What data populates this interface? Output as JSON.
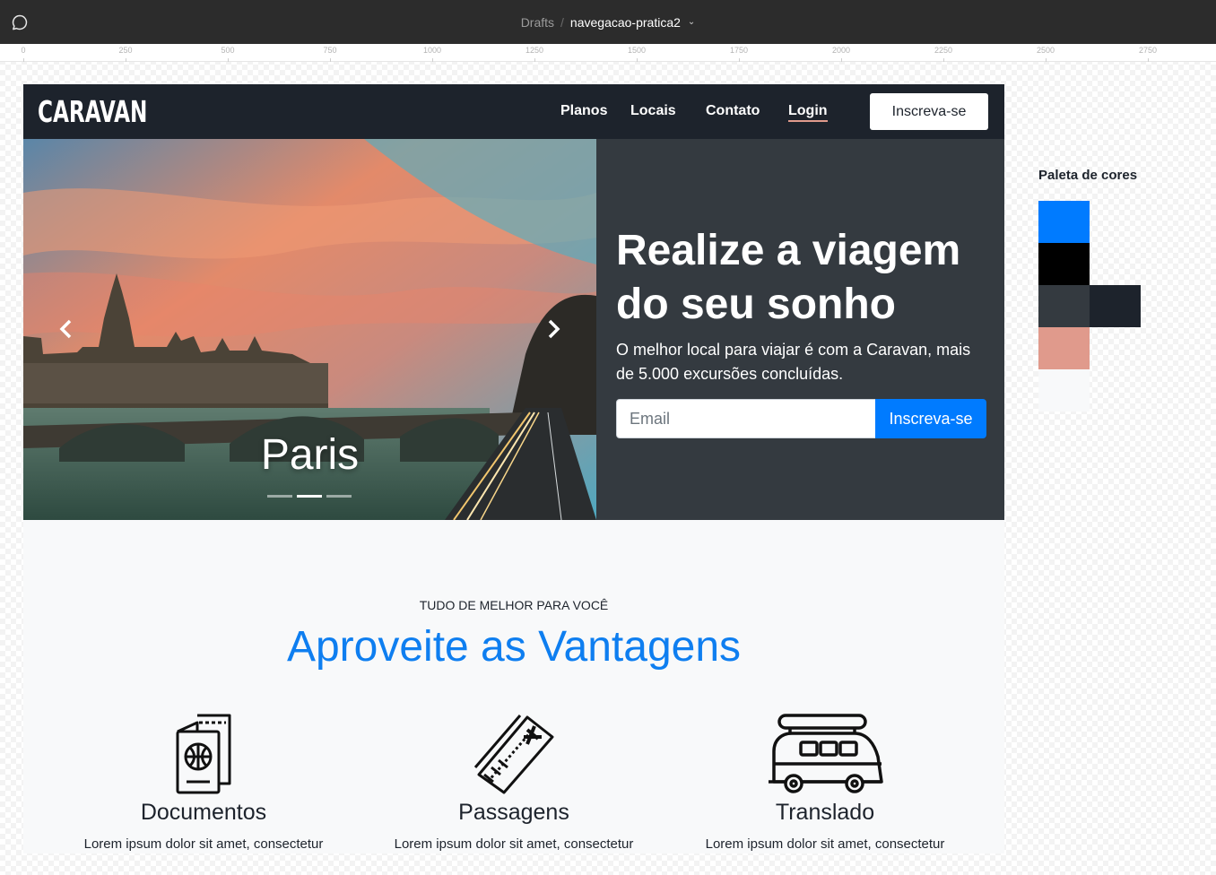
{
  "figma": {
    "breadcrumb_root": "Drafts",
    "breadcrumb_sep": "/",
    "file_name": "navegacao-pratica2",
    "ruler_labels": [
      "0",
      "250",
      "500",
      "750",
      "1000",
      "1250",
      "1500",
      "1750",
      "2000",
      "2250",
      "2500",
      "2750"
    ]
  },
  "navbar": {
    "brand": "CARAVAN",
    "links": [
      "Planos",
      "Locais",
      "Contato",
      "Login"
    ],
    "cta": "Inscreva-se"
  },
  "hero": {
    "slide_caption": "Paris",
    "slide_count": 3,
    "active_slide": 2,
    "title": "Realize a viagem do seu sonho",
    "text": "O melhor local para viajar é com a Caravan, mais de 5.000 excursões concluídas.",
    "email_placeholder": "Email",
    "subscribe_label": "Inscreva-se"
  },
  "features_section": {
    "eyebrow": "TUDO DE MELHOR PARA VOCÊ",
    "title": "Aproveite as Vantagens",
    "items": [
      {
        "icon": "passport-icon",
        "title": "Documentos",
        "text": "Lorem ipsum dolor sit amet, consectetur"
      },
      {
        "icon": "ticket-icon",
        "title": "Passagens",
        "text": "Lorem ipsum dolor sit amet, consectetur"
      },
      {
        "icon": "van-icon",
        "title": "Translado",
        "text": "Lorem ipsum dolor sit amet, consectetur"
      }
    ]
  },
  "palette": {
    "title": "Paleta de cores",
    "colors": [
      "#007bff",
      "#000000",
      "#343a40",
      "#1d232c",
      "#e09a8c",
      "#f8f9fa"
    ]
  }
}
